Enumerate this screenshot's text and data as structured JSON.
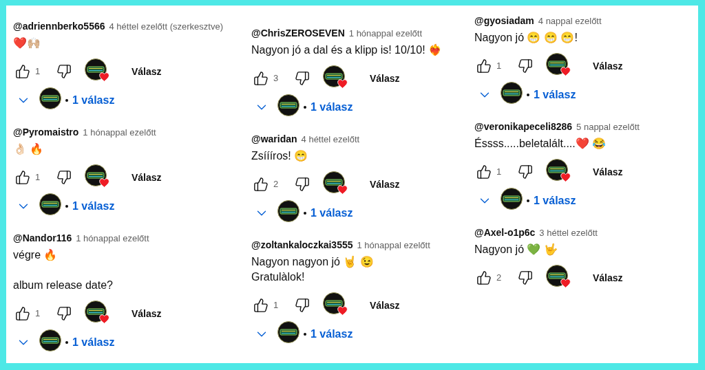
{
  "columns": [
    {
      "comments": [
        {
          "author": "@adriennberko5566",
          "time": "4 héttel ezelőtt (szerkesztve)",
          "text": "❤️🙌🏼",
          "likes": "1",
          "hearted": true,
          "reply_label": "Válasz",
          "replies": "1 válasz"
        },
        {
          "author": "@Pyromaistro",
          "time": "1 hónappal ezelőtt",
          "text": "👌🏻 🔥",
          "likes": "1",
          "hearted": true,
          "reply_label": "Válasz",
          "replies": "1 válasz"
        },
        {
          "author": "@Nandor116",
          "time": "1 hónappal ezelőtt",
          "text": "végre 🔥\n\nalbum release date?",
          "likes": "1",
          "hearted": true,
          "reply_label": "Válasz",
          "replies": "1 válasz"
        }
      ]
    },
    {
      "comments": [
        {
          "author": "@ChrisZEROSEVEN",
          "time": "1 hónappal ezelőtt",
          "text": "Nagyon jó a dal és a klipp is! 10/10! ❤️‍🔥",
          "likes": "3",
          "hearted": true,
          "reply_label": "Válasz",
          "replies": "1 válasz"
        },
        {
          "author": "@waridan",
          "time": "4 héttel ezelőtt",
          "text": "Zsíííros! 😁",
          "likes": "2",
          "hearted": true,
          "reply_label": "Válasz",
          "replies": "1 válasz"
        },
        {
          "author": "@zoltankaloczkai3555",
          "time": "1 hónappal ezelőtt",
          "text": "Nagyon nagyon jó 🤘 😉\nGratulàlok!",
          "likes": "1",
          "hearted": true,
          "reply_label": "Válasz",
          "replies": "1 válasz"
        }
      ]
    },
    {
      "comments": [
        {
          "author": "@gyosiadam",
          "time": "4 nappal ezelőtt",
          "text": "Nagyon jó 😁 😁 😁!",
          "likes": "1",
          "hearted": true,
          "reply_label": "Válasz",
          "replies": "1 válasz"
        },
        {
          "author": "@veronikapeceli8286",
          "time": "5 nappal ezelőtt",
          "text": "Éssss.....beletalált....❤️ 😂",
          "likes": "1",
          "hearted": true,
          "reply_label": "Válasz",
          "replies": "1 válasz"
        },
        {
          "author": "@Axel-o1p6c",
          "time": "3 héttel ezelőtt",
          "text": "Nagyon jó 💚 🤟",
          "likes": "2",
          "hearted": true,
          "reply_label": "Válasz"
        }
      ]
    }
  ]
}
